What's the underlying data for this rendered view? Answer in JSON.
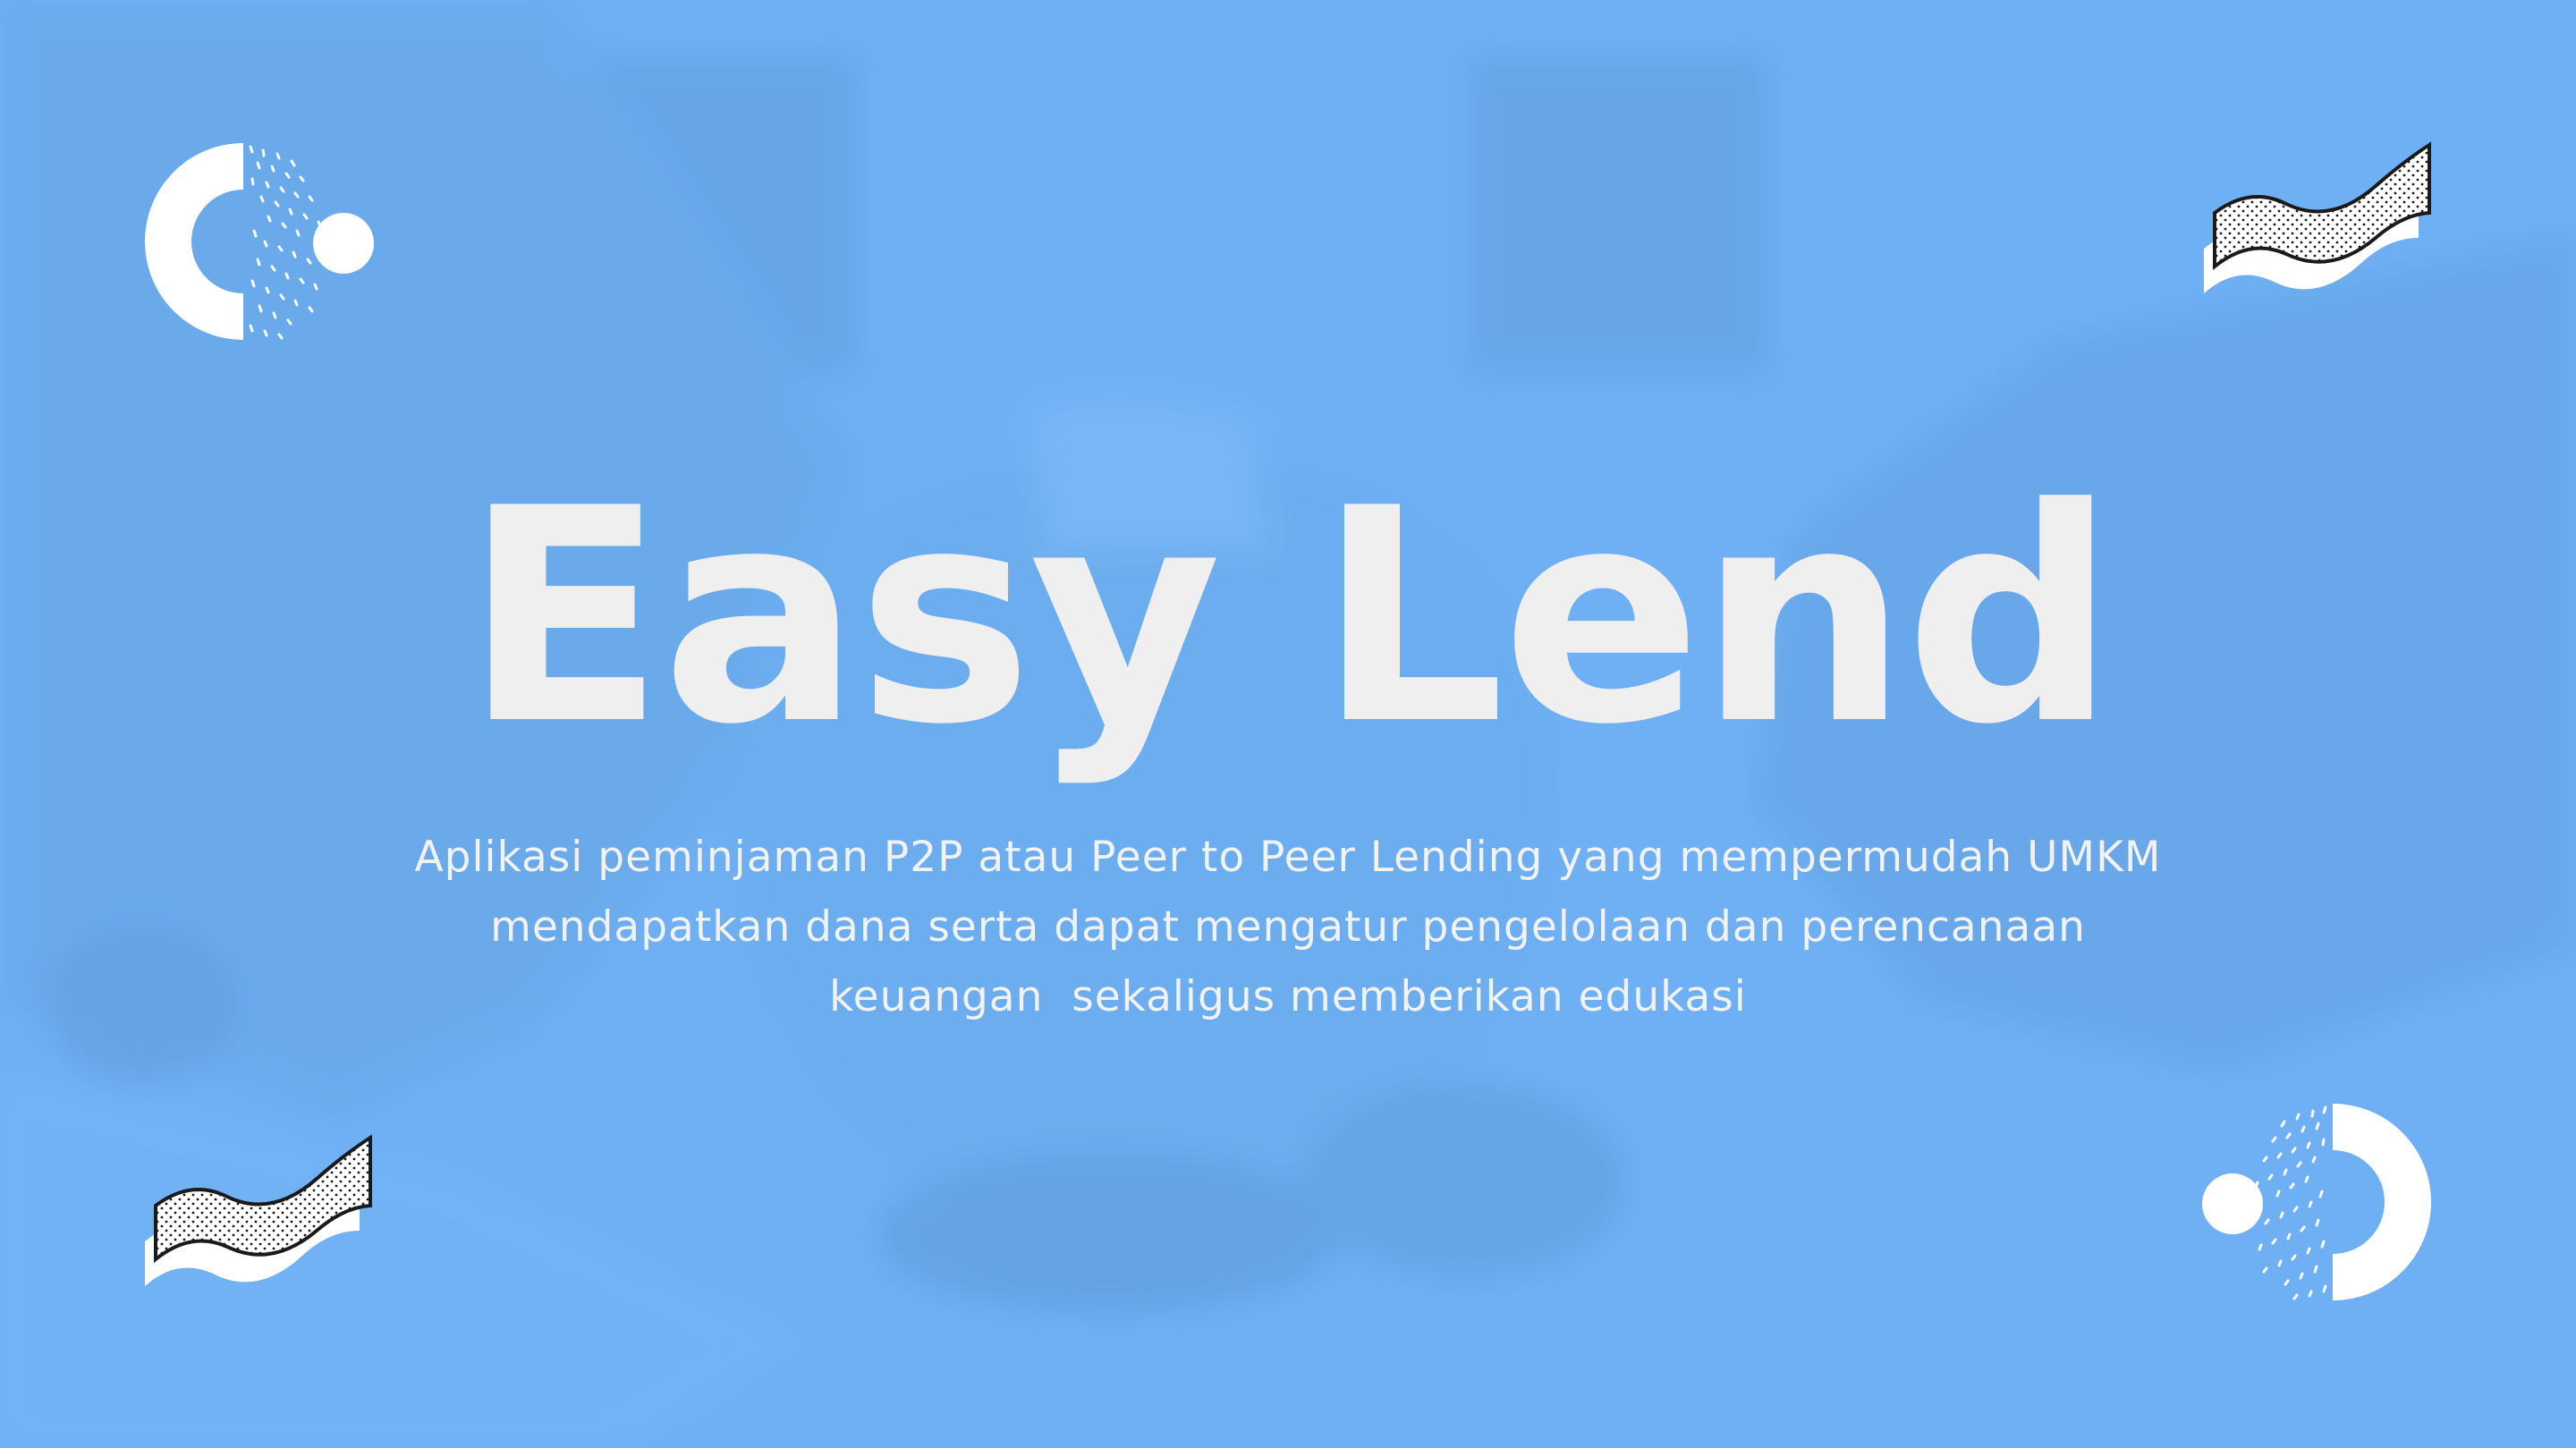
{
  "slide": {
    "title": "Easy Lend",
    "subtitle_lines": [
      "Aplikasi peminjaman P2P atau Peer to Peer Lending yang mempermudah UMKM",
      "mendapatkan dana serta dapat mengatur pengelolaan dan perencanaan",
      "keuangan  sekaligus memberikan edukasi"
    ]
  },
  "theme": {
    "background": "#6fb0f4",
    "title_color": "#efefef",
    "text_color": "#f2f2f2",
    "deco_color": "#ffffff",
    "deco_outline": "#1a1a1a"
  },
  "decorations": {
    "top_left": "dotted-circle-icon",
    "top_right": "dotted-wave-flag-icon",
    "bottom_left": "dotted-wave-flag-icon",
    "bottom_right": "dotted-circle-icon"
  }
}
